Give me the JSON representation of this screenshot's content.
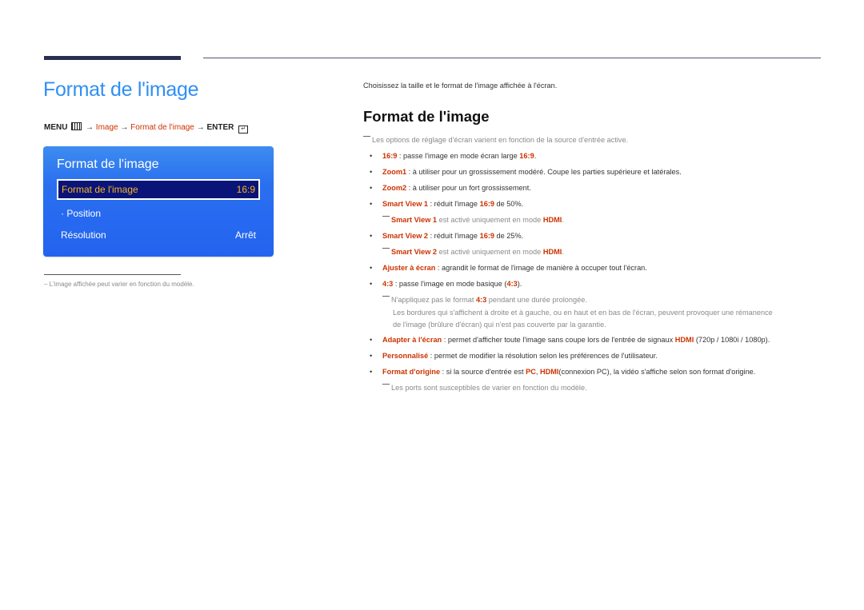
{
  "left": {
    "title": "Format de l'image",
    "menu_path": {
      "menu": "MENU",
      "menu_icon": "menu-grid-icon",
      "arrow": "→",
      "step1": "Image",
      "step2": "Format de l'image",
      "enter": "ENTER",
      "enter_icon": "enter-icon"
    },
    "osd": {
      "title": "Format de l'image",
      "rows": [
        {
          "label": "Format de l'image",
          "value": "16:9",
          "selected": true
        },
        {
          "label": "· Position",
          "value": ""
        },
        {
          "label": "Résolution",
          "value": "Arrêt"
        }
      ]
    },
    "footnote": "–  L'image affichée peut varier en fonction du modèle."
  },
  "right": {
    "intro": "Choisissez la taille et le format de l'image affichée à l'écran.",
    "heading": "Format de l'image",
    "note_top": "Les options de réglage d'écran varient en fonction de la source d'entrée active.",
    "items": [
      {
        "term": "16:9",
        "text": " : passe l'image en mode écran large ",
        "hl2": "16:9",
        "tail": "."
      },
      {
        "term": "Zoom1",
        "text": " : à utiliser pour un grossissement modéré. Coupe les parties supérieure et latérales."
      },
      {
        "term": "Zoom2",
        "text": " : à utiliser pour un fort grossissement."
      },
      {
        "term": "Smart View 1",
        "text": " : réduit l'image ",
        "hl2": "16:9",
        "tail": " de 50%."
      },
      {
        "note_term": "Smart View 1",
        "note_text": " est activé uniquement en mode ",
        "note_hl": "HDMI",
        "note_tail": "."
      },
      {
        "term": "Smart View 2",
        "text": " : réduit l'image ",
        "hl2": "16:9",
        "tail": " de 25%."
      },
      {
        "note_term": "Smart View 2",
        "note_text": " est activé uniquement en mode ",
        "note_hl": "HDMI",
        "note_tail": "."
      },
      {
        "term": "Ajuster à écran",
        "text": " : agrandit le format de l'image de manière à occuper tout l'écran."
      },
      {
        "term": "4:3",
        "text": " : passe l'image en mode basique (",
        "hl2": "4:3",
        "tail": ")."
      },
      {
        "note_pre": "N'appliquez pas le format ",
        "note_hl": "4:3",
        "note_tail": " pendant une durée prolongée.",
        "note_line2": "Les bordures qui s'affichent à droite et à gauche, ou en haut et en bas de l'écran, peuvent provoquer une rémanence",
        "note_line3": "de l'image (brûlure d'écran) qui n'est pas couverte par la garantie."
      },
      {
        "term": "Adapter à l'écran",
        "text": " : permet d'afficher toute l'image sans coupe lors de l'entrée de signaux ",
        "hl2": "HDMI",
        "tail": " (720p / 1080i / 1080p)."
      },
      {
        "term": "Personnalisé",
        "text": " : permet de modifier la résolution selon les préférences de l'utilisateur."
      },
      {
        "term": "Format d'origine",
        "text": " : si la source d'entrée est ",
        "hl2": "PC",
        "mid": ", ",
        "hl3": "HDMI",
        "tail": "(connexion PC), la vidéo s'affiche selon son format d'origine."
      },
      {
        "note_pre": "Les ports sont susceptibles de varier en fonction du modèle."
      }
    ]
  },
  "colors": {
    "title_blue": "#2f8ff5",
    "highlight_red": "#cc3300",
    "osd_blue": "#2a6ff0",
    "osd_selected_bg": "#0a1478",
    "osd_selected_text": "#f5b324",
    "rule_dark": "#2b2f4f"
  }
}
